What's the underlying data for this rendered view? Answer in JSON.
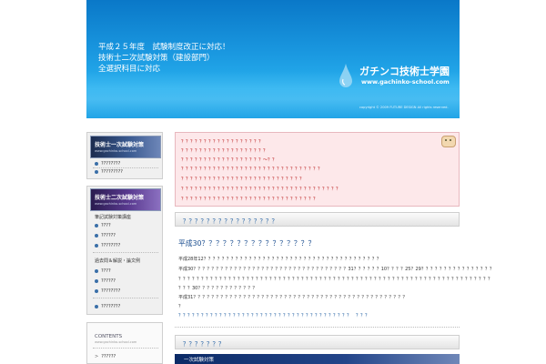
{
  "header": {
    "lines": [
      "平成２５年度　試験制度改正に対応！",
      "技術士二次試験対策（建設部門）",
      "全選択科目に対応"
    ],
    "brand": "ガチンコ技術士学園",
    "url": "www.gachinko-school.com",
    "copyright": "copyright © 2009 FUTURE DESIGN All rights reserved."
  },
  "sidebar": {
    "box1": {
      "banner_title": "技術士一次試験対策",
      "banner_sub": "www.gachinko-school.com",
      "links": [
        "????????",
        "?????????"
      ]
    },
    "box2": {
      "banner_title": "技術士二次試験対策",
      "banner_sub": "www.gachinko-school.com",
      "section1": "筆記試験対策講座",
      "section1_links": [
        "????",
        "??????",
        "????????"
      ],
      "section2": "過去問＆解説・論文例",
      "section2_links": [
        "????",
        "??????",
        "????????"
      ],
      "extra_link": "????????"
    },
    "box3": {
      "title": "CONTENTS",
      "sub": "www.gachinko-school.com",
      "links": [
        "??????"
      ]
    }
  },
  "notice": {
    "lines": [
      "？？？？？？？？？？？？？？？？？？",
      "？？？？？？？？？？？？？？？？？？？",
      "？？？？？？？？？？？？？？？？？？〜？？",
      "？？？？？？？？？？？？？？？？？？？？？？？？？？？？？？？",
      "？？？？？？？？？？？？？？？？？？？？？？？？？？？",
      "？？？？？？？？？？？？？？？？？？？？？？？？？？？？？？？？？？？",
      "？？？？？？？？？？？？？？？？？？？？？？？？？？？？？？"
    ]
  },
  "main": {
    "section1_title": "？？？？？？？？？？？？？？？？",
    "article_title": "平成30？？？？？？？？？？？？？？？？",
    "paragraphs": [
      "平成28年12？？？？？？？？？？？？？？？？？？？？？？？？？？？？？？？？？？？？？？？",
      "平成30？？？？？？？？？？？？？？？？？？？？？？？？？？？？？？？？？？31？？？？？？10？？？？25？29？？？？？？？？？？？？？？？？",
      "？？？？？？？？？？？？？？？？？？？？？？？？？？？？？？？？？？？？？？？？？？？？？？？？？？？？？？？？？？？？？？？？？？？？？",
      "？？？30？？？？？？？？？？？？？",
      "平成31？？？？？？？？？？？？？？？？？？？？？？？？？？？？？？？？？？？？？？？？？？？？？？？",
      "？",
      "？？？？？？？？？？？？？？？？？？？？？？？？？？？？？？？？？？？？？？　？？？"
    ],
    "section2_title": "？？？？？？？",
    "footbar_label": "一次試験対策"
  }
}
